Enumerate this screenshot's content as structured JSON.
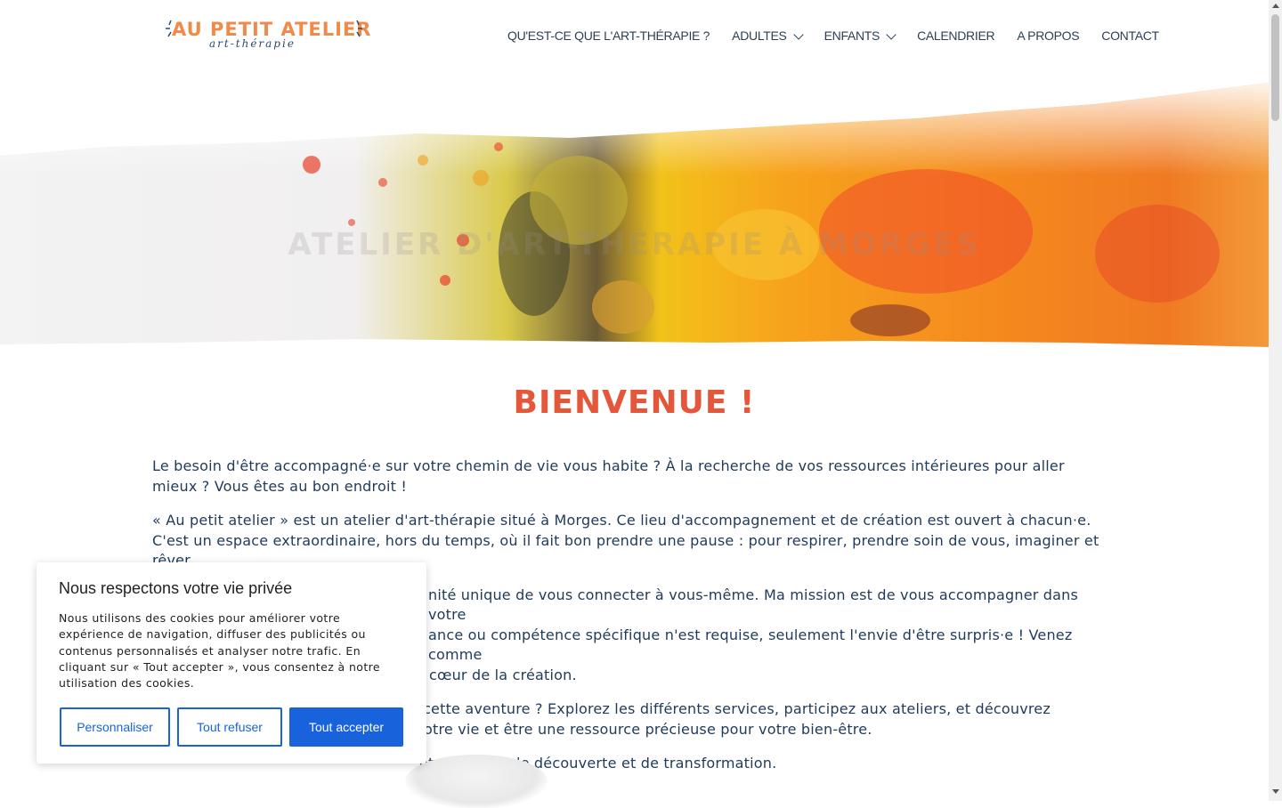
{
  "header": {
    "logo": {
      "main": "AU PETIT ATELIER",
      "sub": "art-thérapie"
    },
    "nav": [
      {
        "label": "QU'EST-CE QUE L'ART-THÉRAPIE ?",
        "dropdown": false
      },
      {
        "label": "ADULTES",
        "dropdown": true
      },
      {
        "label": "ENFANTS",
        "dropdown": true
      },
      {
        "label": "CALENDRIER",
        "dropdown": false
      },
      {
        "label": "A PROPOS",
        "dropdown": false
      },
      {
        "label": "CONTACT",
        "dropdown": false
      }
    ]
  },
  "hero": {
    "title": "ATELIER D'ART-THÉRAPIE À MORGES"
  },
  "main": {
    "heading": "BIENVENUE !",
    "paragraphs": [
      "Le besoin d'être accompagné·e sur votre chemin de vie vous habite ? À la recherche de vos ressources intérieures pour aller mieux ? Vous êtes au bon endroit !",
      "« Au petit atelier » est un atelier d'art-thérapie situé à Morges. Ce lieu d'accompagnement et de création est ouvert à chacun·e. C'est un espace extraordinaire, hors du temps, où il fait bon prendre une pause : pour respirer, prendre soin de vous, imaginer et rêver.",
      "nité unique de vous connecter à vous-même. Ma mission est de vous accompagner dans votre",
      "ance ou compétence spécifique n'est requise, seulement l'envie d'être surpris·e ! Venez comme",
      "cœur de la création.",
      "r cette aventure ? Explorez les différents services, participez aux ateliers, et découvrez",
      "otre vie et être une ressource précieuse pour votre bien-être.",
      "otre voyage de découverte et de transformation."
    ]
  },
  "cookie": {
    "title": "Nous respectons votre vie privée",
    "text": "Nous utilisons des cookies pour améliorer votre expérience de navigation, diffuser des publicités ou contenus personnalisés et analyser notre trafic. En cliquant sur « Tout accepter », vous consentez à notre utilisation des cookies.",
    "customize": "Personnaliser",
    "reject": "Tout refuser",
    "accept": "Tout accepter"
  },
  "colors": {
    "accent": "#e4573a",
    "logo_orange": "#f08a4b",
    "text": "#1f3a5a",
    "button_blue": "#1863dc"
  }
}
